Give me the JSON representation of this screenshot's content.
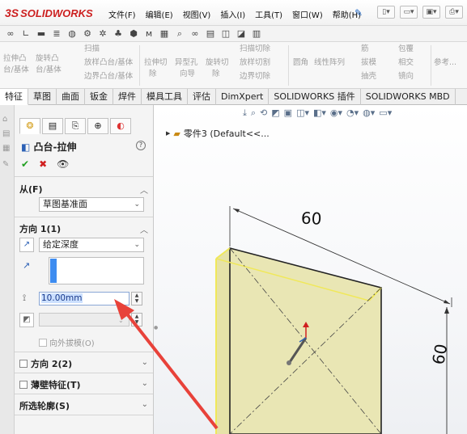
{
  "app": {
    "brand_prefix": "3S",
    "brand_name": "SOLIDWORKS"
  },
  "menu": [
    "文件(F)",
    "编辑(E)",
    "视图(V)",
    "插入(I)",
    "工具(T)",
    "窗口(W)",
    "帮助(H)"
  ],
  "ribbon": {
    "row1": [
      "拉伸凸",
      "旋转凸",
      "扫描",
      "拉伸切",
      "异型孔",
      "旋转切",
      "扫描切除",
      "圆角",
      "线性阵列",
      "筋",
      "包覆",
      "参考..."
    ],
    "row2": [
      "台/基体",
      "台/基体",
      "放样凸台/基体",
      "除",
      "向导",
      "除",
      "放样切割",
      "拔模",
      "相交"
    ],
    "row3": [
      "边界凸台/基体",
      "边界切除",
      "抽壳",
      "镜向"
    ]
  },
  "tabs": [
    "特征",
    "草图",
    "曲面",
    "钣金",
    "焊件",
    "模具工具",
    "评估",
    "DimXpert",
    "SOLIDWORKS 插件",
    "SOLIDWORKS MBD"
  ],
  "active_tab": "特征",
  "property_manager": {
    "title": "凸台-拉伸",
    "help": "?",
    "from": {
      "label": "从(F)",
      "value": "草图基准面"
    },
    "direction1": {
      "label": "方向 1(1)",
      "end_condition": "给定深度",
      "depth_value": "10.00mm",
      "outward_draft_label": "向外拔模(O)"
    },
    "direction2_label": "方向 2(2)",
    "thin_feature_label": "薄壁特征(T)",
    "selected_contours_label": "所选轮廓(S)"
  },
  "feature_tree": {
    "node_label": "零件3 (Default<<..."
  },
  "dimensions": {
    "width": "60",
    "height": "60"
  },
  "colors": {
    "brand_red": "#cc1f1f",
    "preview_fill": "#e6e2a8",
    "preview_edge": "#f0e85a",
    "annotation_arrow": "#e8423a",
    "accent_blue": "#3d8cf0"
  }
}
